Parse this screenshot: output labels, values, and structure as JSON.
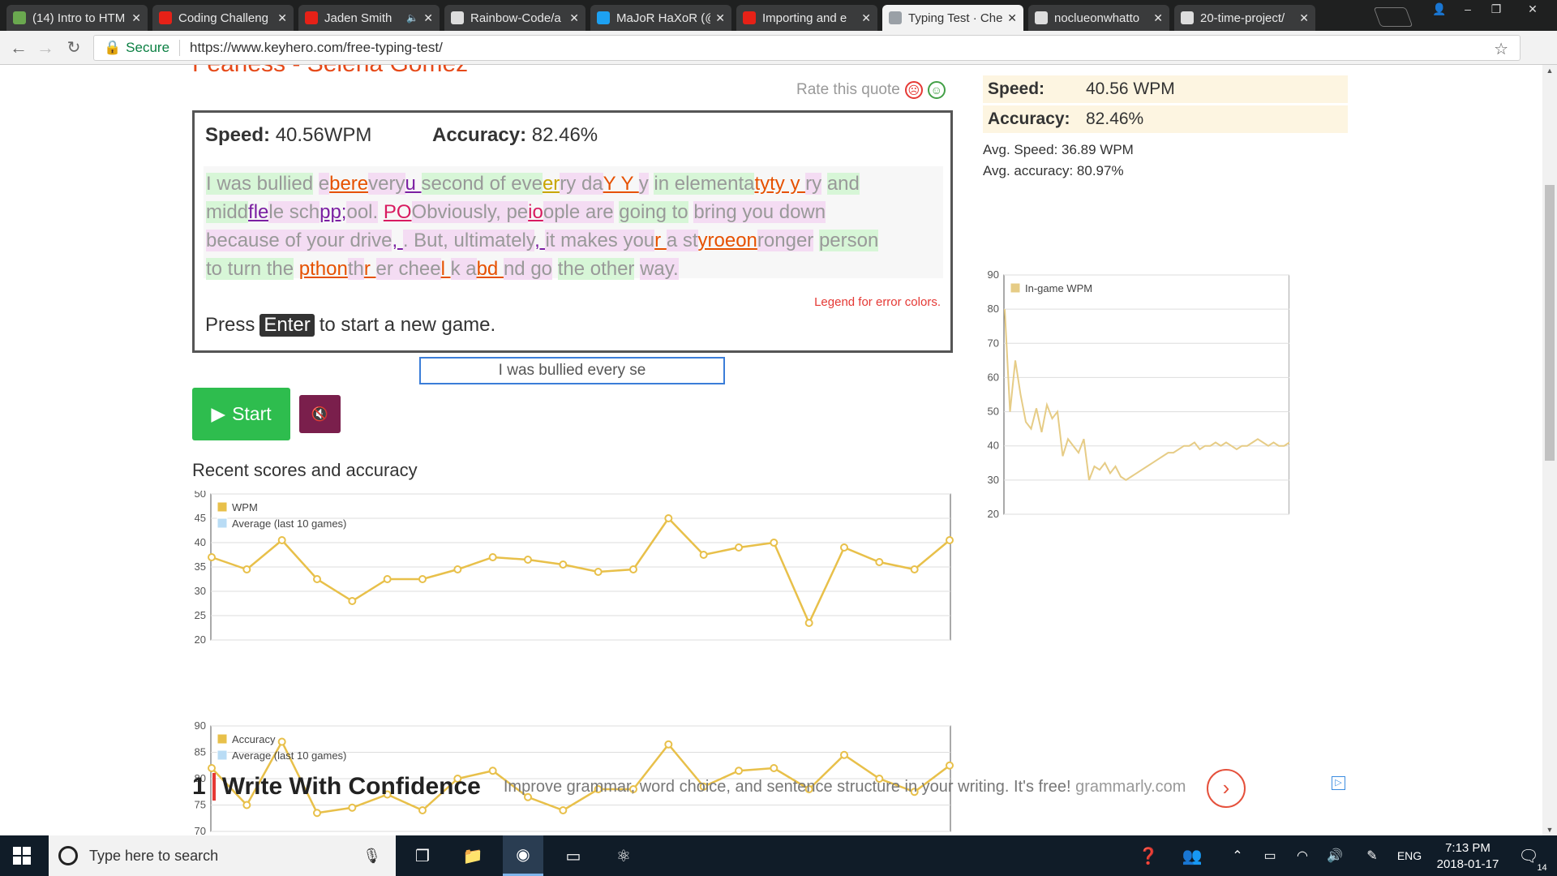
{
  "browser": {
    "tabs": [
      {
        "title": "(14) Intro to HTM",
        "icon": "leaf-icon",
        "color": "#6aa84f"
      },
      {
        "title": "Coding Challeng",
        "icon": "youtube-icon",
        "color": "#e62117"
      },
      {
        "title": "Jaden Smith",
        "icon": "youtube-icon",
        "color": "#e62117",
        "audio": "🔈"
      },
      {
        "title": "Rainbow-Code/a",
        "icon": "github-icon",
        "color": "#dddddd"
      },
      {
        "title": "MaJoR HaXoR (@",
        "icon": "twitter-icon",
        "color": "#1da1f2"
      },
      {
        "title": "Importing and e",
        "icon": "youtube-icon",
        "color": "#e62117"
      },
      {
        "title": "Typing Test · Che",
        "icon": "keyboard-icon",
        "color": "#9aa0a6",
        "active": true
      },
      {
        "title": "noclueonwhatto",
        "icon": "github-icon",
        "color": "#dddddd"
      },
      {
        "title": "20-time-project/",
        "icon": "github-icon",
        "color": "#dddddd"
      }
    ],
    "secure_label": "Secure",
    "url": "https://www.keyhero.com/free-typing-test/"
  },
  "game": {
    "top_cut_text": "Fearless - Selena Gomez",
    "rate_label": "Rate this quote",
    "speed_label": "Speed:",
    "speed_value": "40.56WPM",
    "accuracy_label": "Accuracy:",
    "accuracy_value": "82.46%",
    "legend_link": "Legend for error colors.",
    "press": "Press",
    "enter_key": "Enter",
    "start_new": "to start a new game.",
    "input_value": "I was bullied every se",
    "start_button": "Start"
  },
  "recent_title": "Recent scores and accuracy",
  "sidebar": {
    "speed_label": "Speed:",
    "speed_value": "40.56 WPM",
    "accuracy_label": "Accuracy:",
    "accuracy_value": "82.46%",
    "avg_speed": "Avg. Speed: 36.89 WPM",
    "avg_accuracy": "Avg. accuracy: 80.97%"
  },
  "ad": {
    "num": "1",
    "title": "Write With Confidence",
    "text": "Improve grammar, word choice, and sentence structure in your writing. It's free!",
    "domain": "grammarly.com"
  },
  "taskbar": {
    "search_placeholder": "Type here to search",
    "lang": "ENG",
    "time": "7:13 PM",
    "date": "2018-01-17",
    "notif_count": "14"
  },
  "colors": {
    "wpm_line": "#f0c674",
    "ingame_line": "#e6d08f",
    "start": "#2ebd4e",
    "mute": "#7a1f4c"
  },
  "chart_data": [
    {
      "type": "line",
      "series": [
        {
          "name": "WPM",
          "values": [
            37,
            34.5,
            40.5,
            32.5,
            28,
            32.5,
            32.5,
            34.5,
            37,
            36.5,
            35.5,
            34,
            34.5,
            45,
            37.5,
            39,
            40,
            23.5,
            39,
            36,
            34.5,
            40.5
          ]
        },
        {
          "name": "Average (last 10 games)",
          "values": []
        }
      ],
      "ylim": [
        20,
        50
      ],
      "yticks": [
        20,
        25,
        30,
        35,
        40,
        45,
        50
      ],
      "grid": true,
      "legend": "top-left"
    },
    {
      "type": "line",
      "series": [
        {
          "name": "Accuracy",
          "values": [
            82,
            75,
            87,
            73.5,
            74.5,
            77,
            74,
            80,
            81.5,
            76.5,
            74,
            78,
            78,
            86.5,
            78.5,
            81.5,
            82,
            78,
            84.5,
            80,
            77.5,
            82.5
          ]
        },
        {
          "name": "Average (last 10 games)",
          "values": []
        }
      ],
      "ylim": [
        70,
        90
      ],
      "yticks": [
        70,
        75,
        80,
        85,
        90
      ],
      "grid": true,
      "legend": "top-left"
    },
    {
      "type": "line",
      "series": [
        {
          "name": "In-game WPM",
          "values": [
            80,
            50,
            65,
            55,
            47,
            45,
            51,
            44,
            52,
            48,
            50,
            37,
            42,
            40,
            38,
            42,
            30,
            34,
            33,
            35,
            32,
            34,
            31,
            30,
            31,
            32,
            33,
            34,
            35,
            36,
            37,
            38,
            38,
            39,
            40,
            40,
            41,
            39,
            40,
            40,
            41,
            40,
            41,
            40,
            39,
            40,
            40,
            41,
            42,
            41,
            40,
            41,
            40,
            40,
            41
          ]
        }
      ],
      "ylim": [
        20,
        90
      ],
      "yticks": [
        20,
        30,
        40,
        50,
        60,
        70,
        80,
        90
      ],
      "grid": true,
      "legend": "top-left"
    }
  ]
}
